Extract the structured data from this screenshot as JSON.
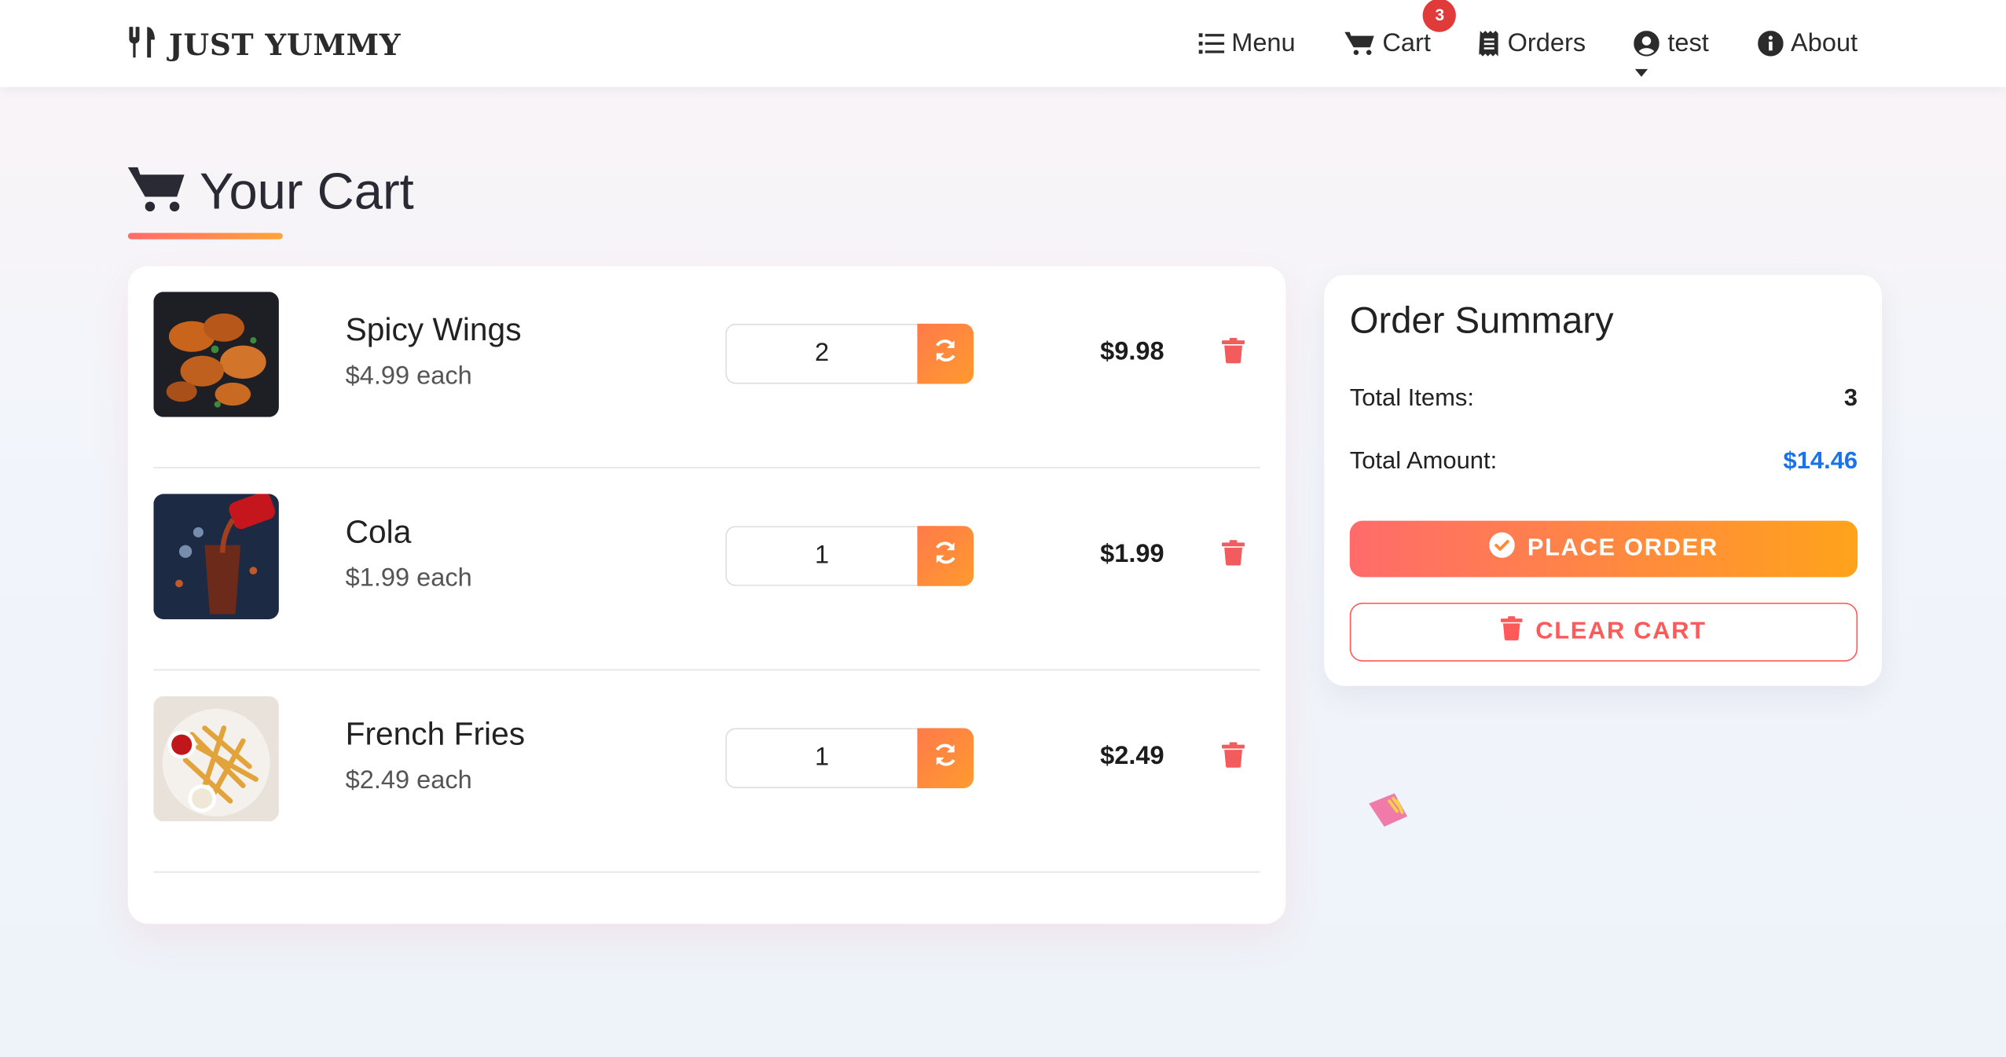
{
  "navbar": {
    "brand": "JUST YUMMY",
    "items": [
      {
        "label": "Menu",
        "icon": "list-icon"
      },
      {
        "label": "Cart",
        "icon": "cart-icon",
        "badge": "3"
      },
      {
        "label": "Orders",
        "icon": "receipt-icon"
      },
      {
        "label": "test",
        "icon": "user-circle-icon"
      },
      {
        "label": "About",
        "icon": "info-circle-icon"
      }
    ]
  },
  "page": {
    "title": "Your Cart",
    "title_icon": "cart-icon"
  },
  "cart": {
    "items": [
      {
        "name": "Spicy Wings",
        "each": "$4.99 each",
        "qty": "2",
        "total": "$9.98",
        "image": "spicy-wings-thumb"
      },
      {
        "name": "Cola",
        "each": "$1.99 each",
        "qty": "1",
        "total": "$1.99",
        "image": "cola-thumb"
      },
      {
        "name": "French Fries",
        "each": "$2.49 each",
        "qty": "1",
        "total": "$2.49",
        "image": "french-fries-thumb"
      }
    ]
  },
  "summary": {
    "title": "Order Summary",
    "total_items_label": "Total Items:",
    "total_items_value": "3",
    "total_amount_label": "Total Amount:",
    "total_amount_value": "$14.46",
    "place_order_label": "PLACE ORDER",
    "clear_cart_label": "CLEAR CART"
  },
  "colors": {
    "accent_start": "#ff6b6b",
    "accent_end": "#ffa31a",
    "danger": "#ff5a5a",
    "amount_blue": "#1a73e8",
    "badge_red": "#e03a3a"
  }
}
